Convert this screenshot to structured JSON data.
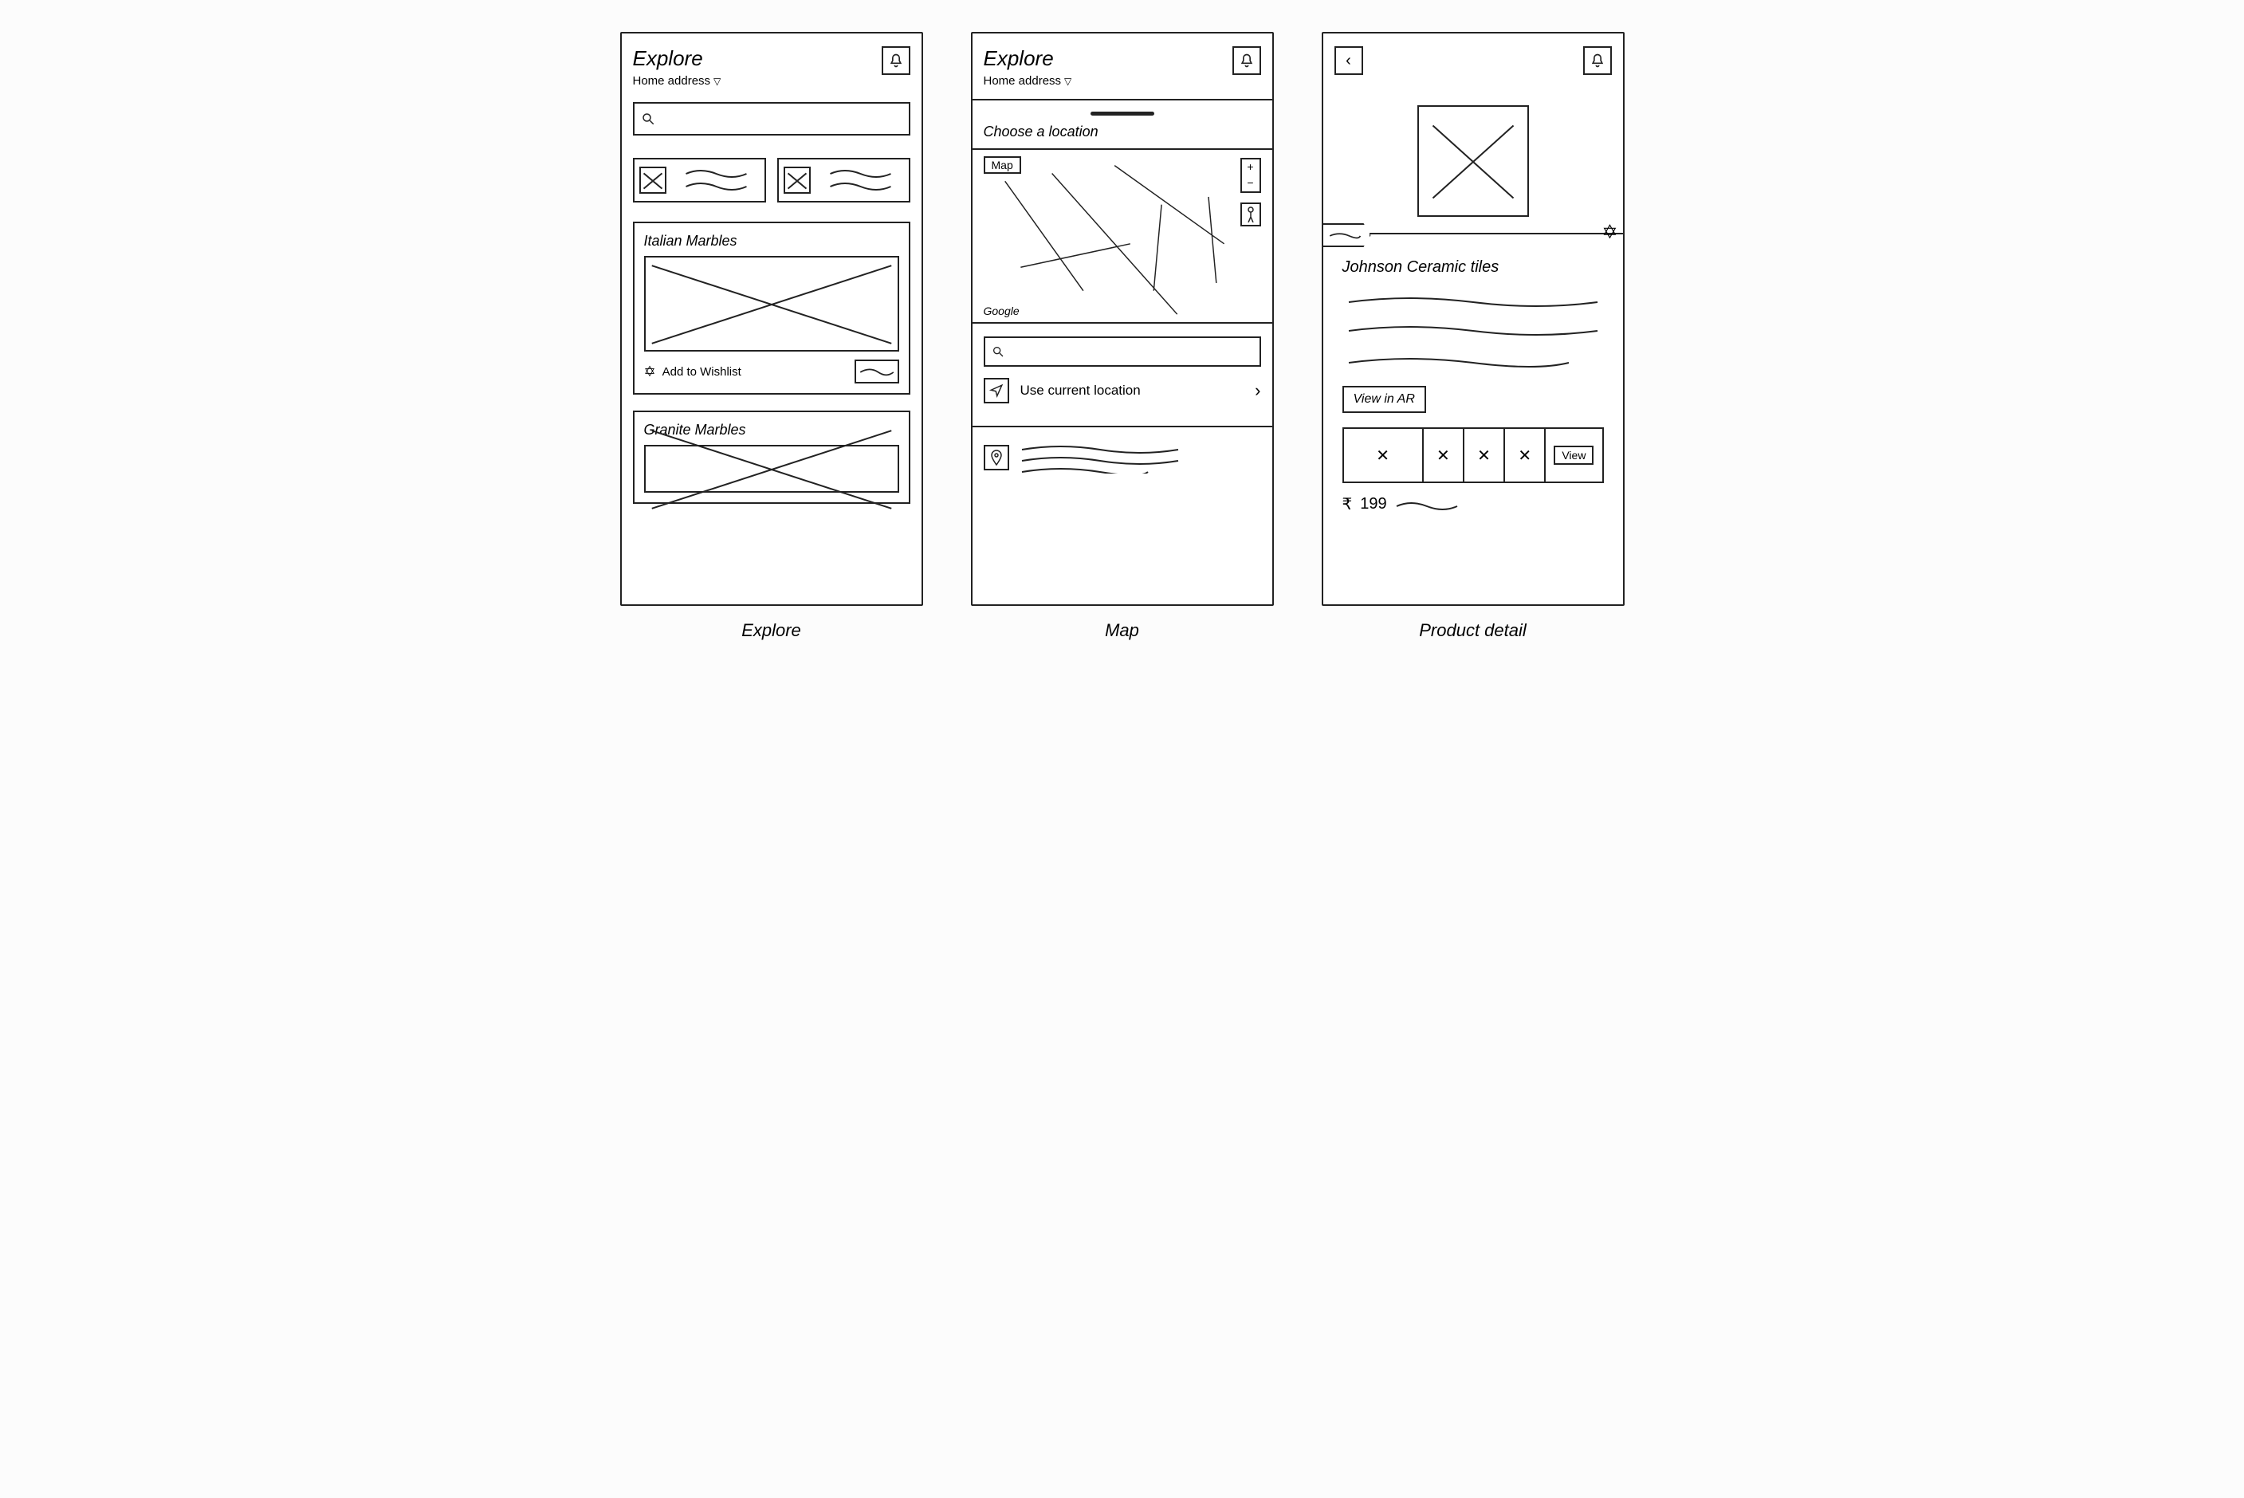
{
  "screens": {
    "explore": {
      "caption": "Explore",
      "title": "Explore",
      "address_label": "Home address",
      "search_placeholder": "",
      "cards": [
        {
          "title": "Italian Marbles",
          "wishlist_label": "Add to Wishlist"
        },
        {
          "title": "Granite Marbles"
        }
      ]
    },
    "map": {
      "caption": "Map",
      "title": "Explore",
      "address_label": "Home address",
      "sheet_title": "Choose a location",
      "map_type_label": "Map",
      "map_attribution": "Google",
      "zoom_in": "+",
      "zoom_out": "−",
      "search_placeholder": "",
      "use_current_label": "Use current location"
    },
    "product": {
      "caption": "Product detail",
      "title": "Johnson Ceramic tiles",
      "view_ar_label": "View in AR",
      "gallery_view_label": "View",
      "currency": "₹",
      "price": "199"
    }
  }
}
